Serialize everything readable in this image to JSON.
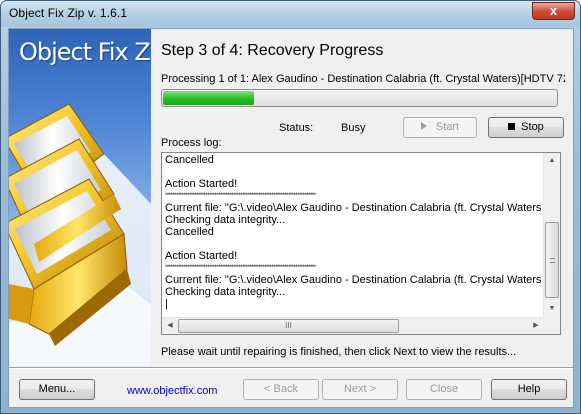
{
  "window": {
    "title": "Object Fix Zip v. 1.6.1",
    "close_label": "x"
  },
  "banner": {
    "title": "Object Fix Zip"
  },
  "wizard": {
    "step_title": "Step 3 of 4: Recovery Progress",
    "processing_text": "Processing 1 of 1: Alex Gaudino - Destination Calabria (ft. Crystal Waters)[HDTV 72",
    "progress_fraction": 0.23,
    "status_label": "Status:",
    "status_value": "Busy",
    "start_label": "Start",
    "stop_label": "Stop",
    "log_label": "Process log:",
    "log_lines": [
      "Cancelled",
      "",
      "Action Started!",
      "**********************************************************************************",
      "Current file: \"G:\\.video\\Alex Gaudino - Destination Calabria (ft. Crystal Waters)(HD",
      "Checking data integrity...",
      "Cancelled",
      "",
      "Action Started!",
      "**********************************************************************************",
      "Current file: \"G:\\.video\\Alex Gaudino - Destination Calabria (ft. Crystal Waters)(HD",
      "Checking data integrity...",
      "|"
    ],
    "hscroll_grip": "III",
    "please_wait": "Please wait until repairing is finished, then click Next to view the results..."
  },
  "footer": {
    "menu_label": "Menu...",
    "link_text": "www.objectfix.com",
    "back_label": "< Back",
    "next_label": "Next >",
    "close_label": "Close",
    "help_label": "Help"
  }
}
